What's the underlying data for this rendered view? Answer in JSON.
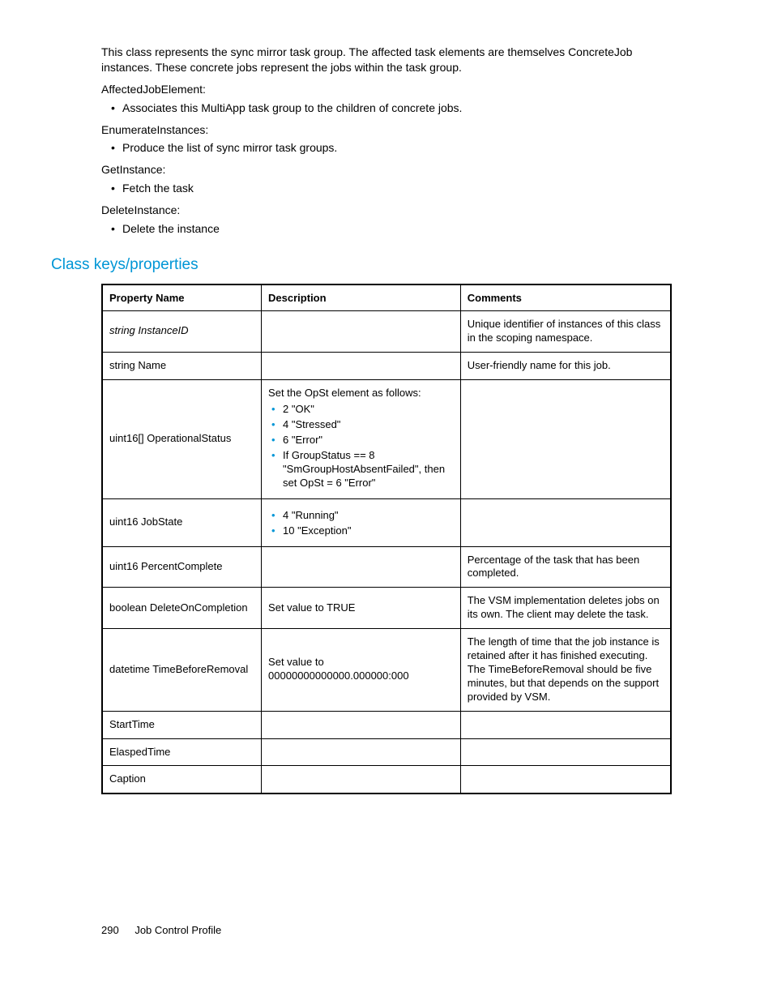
{
  "intro": "This class represents the sync mirror task group. The affected task elements are themselves ConcreteJob instances. These concrete jobs represent the jobs within the task group.",
  "blocks": [
    {
      "label": "AffectedJobElement:",
      "item": "Associates this MultiApp task group to the children of concrete jobs."
    },
    {
      "label": "EnumerateInstances:",
      "item": "Produce the list of sync mirror task groups."
    },
    {
      "label": "GetInstance:",
      "item": "Fetch the task"
    },
    {
      "label": "DeleteInstance:",
      "item": "Delete the instance"
    }
  ],
  "section_heading": "Class keys/properties",
  "table": {
    "headers": {
      "prop": "Property Name",
      "desc": "Description",
      "comm": "Comments"
    },
    "rows": [
      {
        "prop": "string InstanceID",
        "prop_italic": true,
        "desc_text": "",
        "desc_items": [],
        "comm": "Unique identifier of instances of this class in the scoping namespace."
      },
      {
        "prop": "string Name",
        "prop_italic": false,
        "desc_text": "",
        "desc_items": [],
        "comm": "User-friendly name for this job."
      },
      {
        "prop": "uint16[] OperationalStatus",
        "prop_italic": false,
        "desc_text": "Set the OpSt element as follows:",
        "desc_items": [
          "2 \"OK\"",
          "4 \"Stressed\"",
          "6 \"Error\"",
          "If GroupStatus == 8 \"SmGroupHostAbsentFailed\", then set OpSt = 6 \"Error\""
        ],
        "comm": ""
      },
      {
        "prop": "uint16 JobState",
        "prop_italic": false,
        "desc_text": "",
        "desc_items": [
          "4 \"Running\"",
          "10 \"Exception\""
        ],
        "comm": ""
      },
      {
        "prop": "uint16 PercentComplete",
        "prop_italic": false,
        "desc_text": "",
        "desc_items": [],
        "comm": "Percentage of the task that has been completed."
      },
      {
        "prop": "boolean DeleteOnCompletion",
        "prop_italic": false,
        "desc_text": "Set value to TRUE",
        "desc_items": [],
        "comm": "The VSM implementation deletes jobs on its own. The client may delete the task."
      },
      {
        "prop": "datetime TimeBeforeRemoval",
        "prop_italic": false,
        "desc_text": "Set value to 00000000000000.000000:000",
        "desc_items": [],
        "comm": "The length of time that the job instance is retained after it has finished executing. The TimeBeforeRemoval should be five minutes, but that depends on the support provided by VSM."
      },
      {
        "prop": "StartTime",
        "prop_italic": false,
        "desc_text": "",
        "desc_items": [],
        "comm": ""
      },
      {
        "prop": "ElaspedTime",
        "prop_italic": false,
        "desc_text": "",
        "desc_items": [],
        "comm": ""
      },
      {
        "prop": "Caption",
        "prop_italic": false,
        "desc_text": "",
        "desc_items": [],
        "comm": ""
      }
    ]
  },
  "footer": {
    "page": "290",
    "title": "Job Control Profile"
  }
}
